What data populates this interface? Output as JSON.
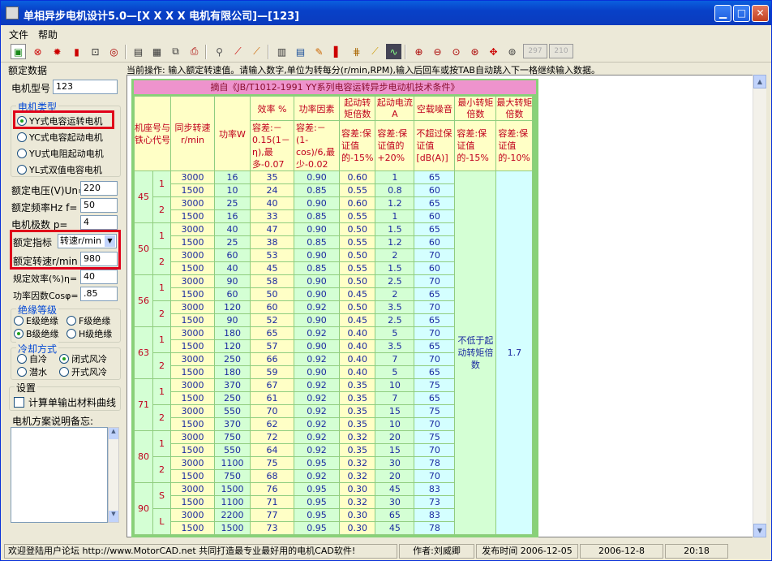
{
  "window": {
    "title": "单相异步电机设计5.0—[X X X X 电机有限公司]—[123]"
  },
  "menu": [
    "文件",
    "帮助"
  ],
  "toolbar": {
    "zoom_a": "297",
    "zoom_b": "210"
  },
  "left": {
    "section_title": "额定数据",
    "model_label": "电机型号",
    "model_value": "123",
    "type_group_title": "电机类型",
    "types": [
      "YY式电容运转电机",
      "YC式电容起动电机",
      "YU式电阻起动电机",
      "YL式双值电容电机"
    ],
    "voltage_label": "额定电压(V)Un=",
    "voltage_value": "220",
    "freq_label": "额定频率Hz f=",
    "freq_value": "50",
    "poles_label": "电机极数    p=",
    "poles_value": "4",
    "index_label": "额定指标",
    "index_value": "转速r/min",
    "speed_label": "额定转速r/min",
    "speed_value": "980",
    "eff_label": "规定效率(%)η=",
    "eff_value": "40",
    "pf_label": "功率因数Cosφ=",
    "pf_value": ".85",
    "insul_title": "绝缘等级",
    "insul": [
      "E级绝缘",
      "F级绝缘",
      "B级绝缘",
      "H级绝缘"
    ],
    "cool_title": "冷却方式",
    "cool": [
      "自冷",
      "闭式风冷",
      "潜水",
      "开式风冷"
    ],
    "settings_title": "设置",
    "settings_check": "计算单输出材料曲线",
    "memo_label": "电机方案说明备忘:"
  },
  "operation_text": "当前操作: 输入额定转速值。请输入数字,单位为转每分(r/min,RPM),输入后回车或按TAB自动跳入下一格继续输入数据。",
  "table": {
    "caption": "摘自《JB/T1012-1991 YY系列电容运转异步电动机技术条件》",
    "headers": [
      "机座号与铁心代号",
      "同步转速r/min",
      "功率W",
      "效率 %",
      "功率因素",
      "起动转矩倍数",
      "起动电流A",
      "空载噪音",
      "最小转矩倍数",
      "最大转矩倍数"
    ],
    "tolerances": [
      "容差:－0.15(1－η),最多-0.07",
      "容差:－(1-cos)/6,最少-0.02",
      "容差:保证值的-15%",
      "容差:保证值的+20%",
      "不超过保证值[dB(A)]",
      "容差:保证值的-15%",
      "容差:保证值的-10%"
    ],
    "groups": [
      {
        "seat": "45",
        "cores": [
          {
            "code": "1",
            "rows": [
              [
                "3000",
                "16",
                "35",
                "0.90",
                "0.60",
                "1",
                "65"
              ],
              [
                "1500",
                "10",
                "24",
                "0.85",
                "0.55",
                "0.8",
                "60"
              ]
            ]
          },
          {
            "code": "2",
            "rows": [
              [
                "3000",
                "25",
                "40",
                "0.90",
                "0.60",
                "1.2",
                "65"
              ],
              [
                "1500",
                "16",
                "33",
                "0.85",
                "0.55",
                "1",
                "60"
              ]
            ]
          }
        ]
      },
      {
        "seat": "50",
        "cores": [
          {
            "code": "1",
            "rows": [
              [
                "3000",
                "40",
                "47",
                "0.90",
                "0.50",
                "1.5",
                "65"
              ],
              [
                "1500",
                "25",
                "38",
                "0.85",
                "0.55",
                "1.2",
                "60"
              ]
            ]
          },
          {
            "code": "2",
            "rows": [
              [
                "3000",
                "60",
                "53",
                "0.90",
                "0.50",
                "2",
                "70"
              ],
              [
                "1500",
                "40",
                "45",
                "0.85",
                "0.55",
                "1.5",
                "60"
              ]
            ]
          }
        ]
      },
      {
        "seat": "56",
        "cores": [
          {
            "code": "1",
            "rows": [
              [
                "3000",
                "90",
                "58",
                "0.90",
                "0.50",
                "2.5",
                "70"
              ],
              [
                "1500",
                "60",
                "50",
                "0.90",
                "0.45",
                "2",
                "65"
              ]
            ]
          },
          {
            "code": "2",
            "rows": [
              [
                "3000",
                "120",
                "60",
                "0.92",
                "0.50",
                "3.5",
                "70"
              ],
              [
                "1500",
                "90",
                "52",
                "0.90",
                "0.45",
                "2.5",
                "65"
              ]
            ]
          }
        ]
      },
      {
        "seat": "63",
        "cores": [
          {
            "code": "1",
            "rows": [
              [
                "3000",
                "180",
                "65",
                "0.92",
                "0.40",
                "5",
                "70"
              ],
              [
                "1500",
                "120",
                "57",
                "0.90",
                "0.40",
                "3.5",
                "65"
              ]
            ]
          },
          {
            "code": "2",
            "rows": [
              [
                "3000",
                "250",
                "66",
                "0.92",
                "0.40",
                "7",
                "70"
              ],
              [
                "1500",
                "180",
                "59",
                "0.90",
                "0.40",
                "5",
                "65"
              ]
            ]
          }
        ]
      },
      {
        "seat": "71",
        "cores": [
          {
            "code": "1",
            "rows": [
              [
                "3000",
                "370",
                "67",
                "0.92",
                "0.35",
                "10",
                "75"
              ],
              [
                "1500",
                "250",
                "61",
                "0.92",
                "0.35",
                "7",
                "65"
              ]
            ]
          },
          {
            "code": "2",
            "rows": [
              [
                "3000",
                "550",
                "70",
                "0.92",
                "0.35",
                "15",
                "75"
              ],
              [
                "1500",
                "370",
                "62",
                "0.92",
                "0.35",
                "10",
                "70"
              ]
            ]
          }
        ]
      },
      {
        "seat": "80",
        "cores": [
          {
            "code": "1",
            "rows": [
              [
                "3000",
                "750",
                "72",
                "0.92",
                "0.32",
                "20",
                "75"
              ],
              [
                "1500",
                "550",
                "64",
                "0.92",
                "0.35",
                "15",
                "70"
              ]
            ]
          },
          {
            "code": "2",
            "rows": [
              [
                "3000",
                "1100",
                "75",
                "0.95",
                "0.32",
                "30",
                "78"
              ],
              [
                "1500",
                "750",
                "68",
                "0.92",
                "0.32",
                "20",
                "70"
              ]
            ]
          }
        ]
      },
      {
        "seat": "90",
        "cores": [
          {
            "code": "S",
            "rows": [
              [
                "3000",
                "1500",
                "76",
                "0.95",
                "0.30",
                "45",
                "83"
              ],
              [
                "1500",
                "1100",
                "71",
                "0.95",
                "0.32",
                "30",
                "73"
              ]
            ]
          },
          {
            "code": "L",
            "rows": [
              [
                "3000",
                "2200",
                "77",
                "0.95",
                "0.30",
                "65",
                "83"
              ],
              [
                "1500",
                "1500",
                "73",
                "0.95",
                "0.30",
                "45",
                "78"
              ]
            ]
          }
        ]
      }
    ],
    "min_torque_text": "不低于起动转矩倍数",
    "max_torque_value": "1.7"
  },
  "status": {
    "welcome": "欢迎登陆用户论坛 http://www.MotorCAD.net 共同打造最专业最好用的电机CAD软件!",
    "author": "作者:刘威卿",
    "release": "发布时间 2006-12-05",
    "date": "2006-12-8",
    "time": "20:18"
  }
}
